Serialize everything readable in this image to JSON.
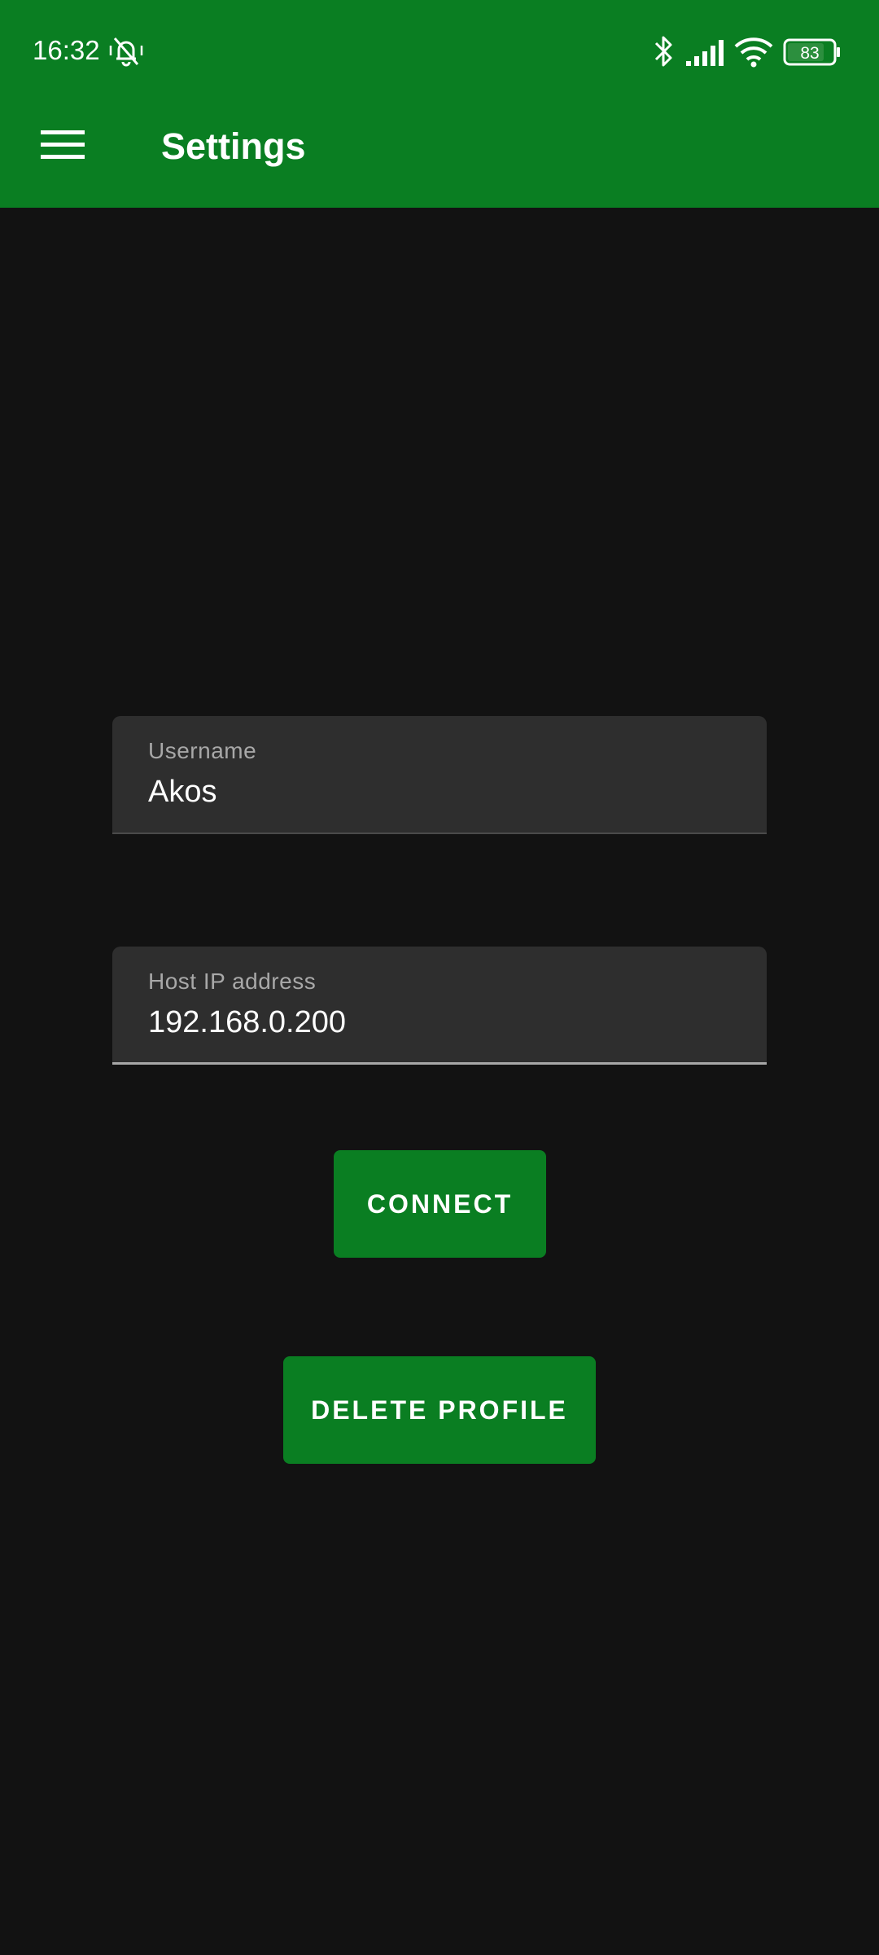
{
  "status_bar": {
    "time": "16:32",
    "icons": [
      "bell-off-vibrate-icon",
      "bluetooth-icon",
      "signal-icon",
      "wifi-icon",
      "battery-icon"
    ],
    "battery_level": "83"
  },
  "app_bar": {
    "title": "Settings",
    "menu_icon": "hamburger-menu-icon"
  },
  "form": {
    "username": {
      "label": "Username",
      "value": "Akos"
    },
    "host_ip": {
      "label": "Host IP address",
      "value": "192.168.0.200"
    }
  },
  "buttons": {
    "connect_label": "CONNECT",
    "delete_profile_label": "DELETE PROFILE"
  },
  "colors": {
    "primary": "#0a7e22",
    "background": "#121212",
    "field_background": "#2e2e2e",
    "text_primary": "#ffffff",
    "text_secondary": "#a8a8a8"
  }
}
